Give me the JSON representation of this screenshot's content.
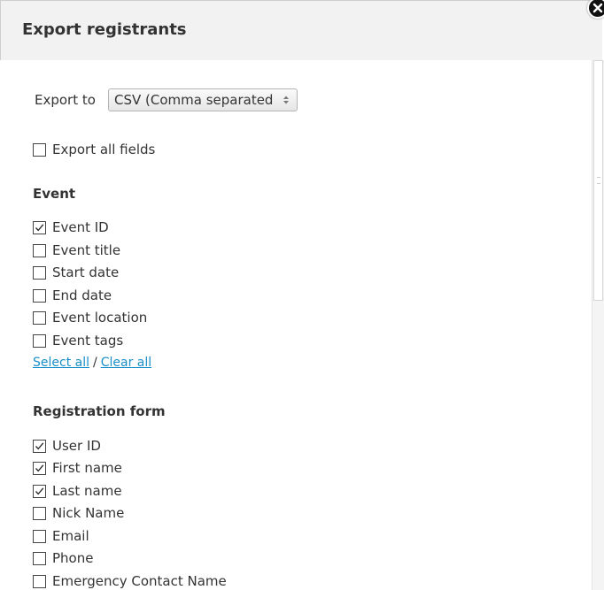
{
  "dialog": {
    "title": "Export registrants"
  },
  "export": {
    "label": "Export to",
    "selected": "CSV (Comma separated"
  },
  "export_all": {
    "label": "Export all fields",
    "checked": false
  },
  "event_section": {
    "heading": "Event",
    "fields": [
      {
        "label": "Event ID",
        "checked": true
      },
      {
        "label": "Event title",
        "checked": false
      },
      {
        "label": "Start date",
        "checked": false
      },
      {
        "label": "End date",
        "checked": false
      },
      {
        "label": "Event location",
        "checked": false
      },
      {
        "label": "Event tags",
        "checked": false
      }
    ],
    "select_all": "Select all",
    "separator": "/",
    "clear_all": "Clear all"
  },
  "registration_section": {
    "heading": "Registration form",
    "fields": [
      {
        "label": "User ID",
        "checked": true
      },
      {
        "label": "First name",
        "checked": true
      },
      {
        "label": "Last name",
        "checked": true
      },
      {
        "label": "Nick Name",
        "checked": false
      },
      {
        "label": "Email",
        "checked": false
      },
      {
        "label": "Phone",
        "checked": false
      },
      {
        "label": "Emergency Contact Name",
        "checked": false
      }
    ]
  },
  "icons": {
    "close": "close-icon",
    "select_arrows": "select-arrows-icon",
    "check": "checkmark-icon"
  },
  "colors": {
    "header_bg": "#f2f2f2",
    "link": "#1a8fc9",
    "text": "#333333"
  }
}
